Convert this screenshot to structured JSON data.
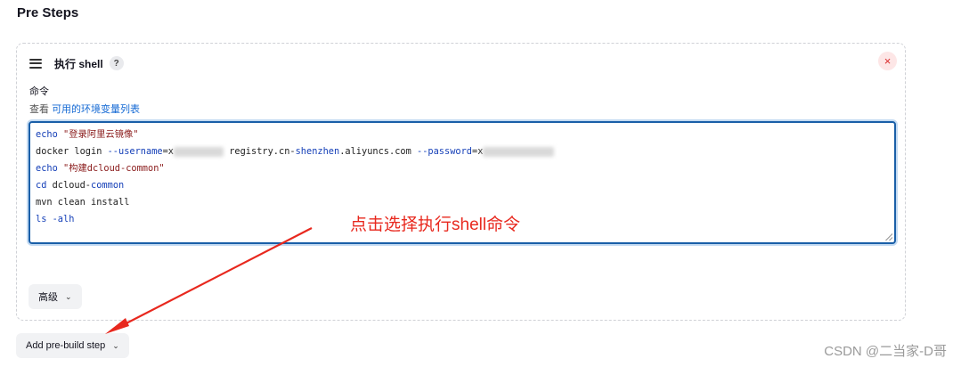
{
  "section": {
    "title": "Pre Steps"
  },
  "step": {
    "name": "执行 shell",
    "help_label": "?",
    "close_label": "×",
    "command_label": "命令",
    "env_prefix": "查看 ",
    "env_link": "可用的环境变量列表"
  },
  "script": {
    "line1_kw": "echo",
    "line1_str": " \"登录阿里云镜像\"",
    "line2_a": "docker login ",
    "line2_flag1": "--username",
    "line2_b": "=x",
    "line2_c": " registry.cn-",
    "line2_kw": "shenzhen",
    "line2_d": ".aliyuncs.com ",
    "line2_flag2": "--password",
    "line2_e": "=x",
    "line3_kw": "echo",
    "line3_str": " \"构建dcloud-common\"",
    "line4_kw": "cd",
    "line4_a": " dcloud-",
    "line4_b": "common",
    "line5": "mvn clean install",
    "line6": "ls -alh"
  },
  "buttons": {
    "advanced": "高级",
    "add_prebuild": "Add pre-build step",
    "chevron": "⌄"
  },
  "annotation": {
    "text": "点击选择执行shell命令",
    "color": "#e8281e"
  },
  "watermark": "CSDN @二当家-D哥",
  "colors": {
    "accent": "#1469d4",
    "editor_border": "#1a5fa8",
    "close": "#d92a2a"
  }
}
